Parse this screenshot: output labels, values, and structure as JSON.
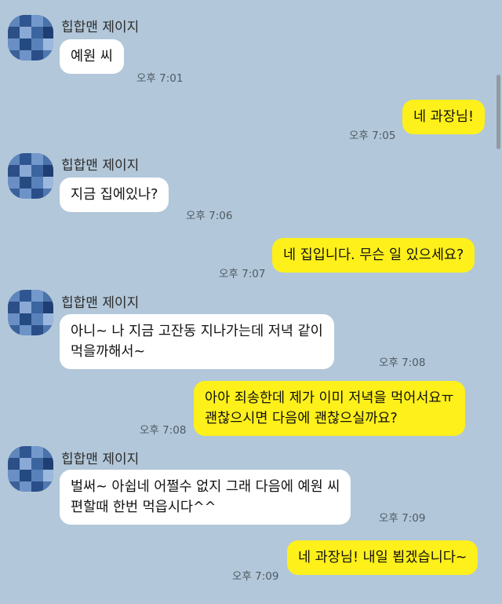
{
  "chat": {
    "messages": [
      {
        "type": "in",
        "sender": "힙합맨 제이지",
        "lines": [
          "예원 씨"
        ],
        "time": "오후 7:01"
      },
      {
        "type": "out",
        "lines": [
          "네 과장님!"
        ],
        "time": "오후 7:05"
      },
      {
        "type": "in",
        "sender": "힙합맨 제이지",
        "lines": [
          "지금 집에있나?"
        ],
        "time": "오후 7:06"
      },
      {
        "type": "out",
        "lines": [
          "네 집입니다. 무슨 일 있으세요?"
        ],
        "time": "오후 7:07"
      },
      {
        "type": "in",
        "sender": "힙합맨 제이지",
        "lines": [
          "아니~ 나 지금 고잔동 지나가는데 저녁 같이",
          "먹을까해서~"
        ],
        "time": "오후 7:08"
      },
      {
        "type": "out",
        "lines": [
          "아아 죄송한데 제가 이미 저녁을 먹어서요ㅠ",
          "괜찮으시면 다음에 괜찮으실까요?"
        ],
        "time": "오후 7:08"
      },
      {
        "type": "in",
        "sender": "힙합맨 제이지",
        "lines": [
          "벌써~ 아쉽네 어쩔수 없지 그래 다음에 예원 씨",
          "편할때 한번 먹읍시다^^"
        ],
        "time": "오후 7:09"
      },
      {
        "type": "out",
        "lines": [
          "네 과장님! 내일 뵙겠습니다~"
        ],
        "time": "오후 7:09"
      }
    ]
  },
  "colors": {
    "background": "#b2c7d9",
    "incoming_bubble": "#ffffff",
    "outgoing_bubble": "#fef01b",
    "avatar_blue": "#3b5f97"
  },
  "icons": {
    "avatar": "pixelated-profile-avatar-icon"
  }
}
